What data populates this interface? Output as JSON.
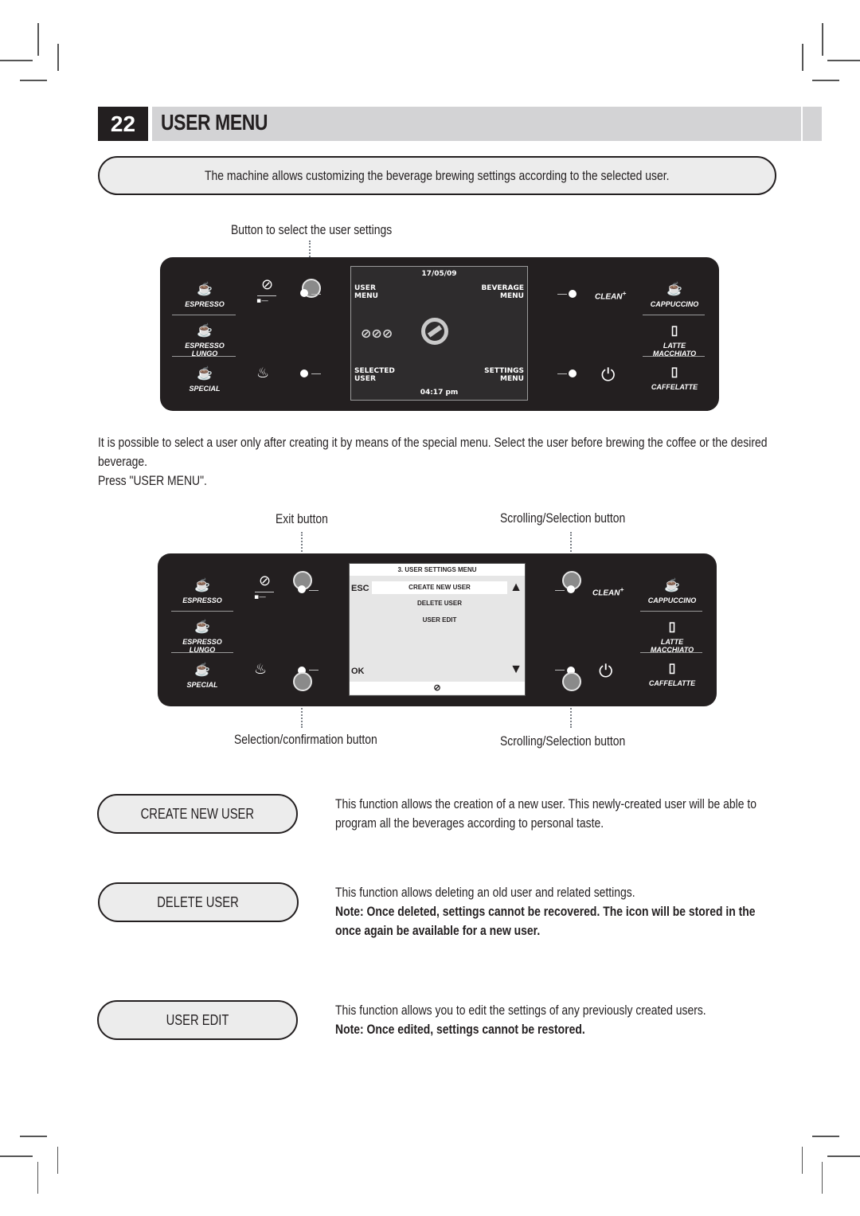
{
  "header": {
    "number": "22",
    "title": "USER MENU"
  },
  "intro": "The machine allows customizing the beverage brewing settings according to the selected user.",
  "panel1": {
    "callout": "Button to select the user settings",
    "beverages_left": [
      "ESPRESSO",
      "ESPRESSO LUNGO",
      "SPECIAL"
    ],
    "beverages_right": [
      "CAPPUCCINO",
      "LATTE MACCHIATO",
      "CAFFELATTE"
    ],
    "clean_label": "CLEAN",
    "screen": {
      "date": "17/05/09",
      "top_left": [
        "USER",
        "MENU"
      ],
      "top_right": [
        "BEVERAGE",
        "MENU"
      ],
      "bottom_left": [
        "SELECTED",
        "USER"
      ],
      "bottom_right": [
        "SETTINGS",
        "MENU"
      ],
      "time": "04:17 pm"
    }
  },
  "instructions": {
    "line1": "It is possible to select a user only after creating it by means of the special menu. Select the user before brewing the coffee or the desired",
    "line2": "beverage.",
    "line3": "Press \"USER MENU\"."
  },
  "panel2": {
    "callouts": {
      "exit": "Exit button",
      "scroll_top": "Scrolling/Selection button",
      "confirm": "Selection/confirmation button",
      "scroll_bottom": "Scrolling/Selection button"
    },
    "beverages_left": [
      "ESPRESSO",
      "ESPRESSO LUNGO",
      "SPECIAL"
    ],
    "beverages_right": [
      "CAPPUCCINO",
      "LATTE MACCHIATO",
      "CAFFELATTE"
    ],
    "clean_label": "CLEAN",
    "screen": {
      "title": "3. USER SETTINGS MENU",
      "esc": "ESC",
      "ok": "OK",
      "items": [
        "CREATE NEW USER",
        "DELETE USER",
        "USER EDIT"
      ],
      "selected_index": 0
    }
  },
  "functions": [
    {
      "label": "CREATE NEW USER",
      "desc": [
        "This function allows the creation of a new user. This newly-created user will be able to",
        "program all the beverages according to personal taste."
      ],
      "note": []
    },
    {
      "label": "DELETE USER",
      "desc": [
        "This function allows deleting an old user and related settings."
      ],
      "note": [
        "Note: Once deleted, settings cannot be recovered. The icon will be stored in the",
        "once again be available for a new user."
      ]
    },
    {
      "label": "USER EDIT",
      "desc": [
        "This function allows you to edit the settings of any previously created users."
      ],
      "note": [
        "Note: Once edited, settings cannot be restored."
      ]
    }
  ]
}
